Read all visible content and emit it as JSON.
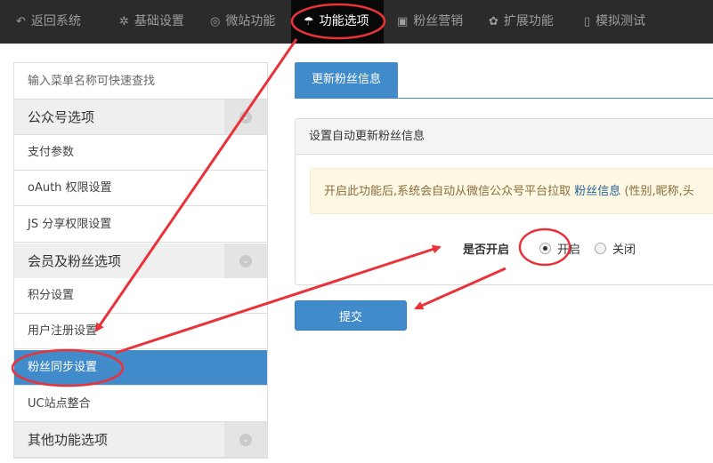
{
  "topnav": {
    "items": [
      {
        "label": "返回系统",
        "icon": "reply-icon"
      },
      {
        "label": "基础设置",
        "icon": "gear-icon"
      },
      {
        "label": "微站功能",
        "icon": "lifebuoy-icon"
      },
      {
        "label": "功能选项",
        "icon": "umbrella-icon"
      },
      {
        "label": "粉丝营销",
        "icon": "gift-icon"
      },
      {
        "label": "扩展功能",
        "icon": "gears-icon"
      },
      {
        "label": "模拟测试",
        "icon": "mobile-icon"
      }
    ]
  },
  "sidebar": {
    "search_placeholder": "输入菜单名称可快速查找",
    "items": [
      {
        "label": "公众号选项"
      },
      {
        "label": "支付参数"
      },
      {
        "label": "oAuth 权限设置"
      },
      {
        "label": "JS 分享权限设置"
      },
      {
        "label": "会员及粉丝选项"
      },
      {
        "label": "积分设置"
      },
      {
        "label": "用户注册设置"
      },
      {
        "label": "粉丝同步设置"
      },
      {
        "label": "UC站点整合"
      },
      {
        "label": "其他功能选项"
      }
    ]
  },
  "main": {
    "tab_label": "更新粉丝信息",
    "panel_title": "设置自动更新粉丝信息",
    "alert_text_before": "开启此功能后,系统会自动从微信公众号平台拉取",
    "alert_link": "粉丝信息",
    "alert_text_after": "(性别,昵称,头",
    "field_label": "是否开启",
    "radio_on_label": "开启",
    "radio_off_label": "关闭",
    "radio_selected": "开启",
    "submit_label": "提交"
  },
  "colors": {
    "accent": "#428bca",
    "nav_bg": "#2b2b2b",
    "annotation": "#e8333a"
  }
}
